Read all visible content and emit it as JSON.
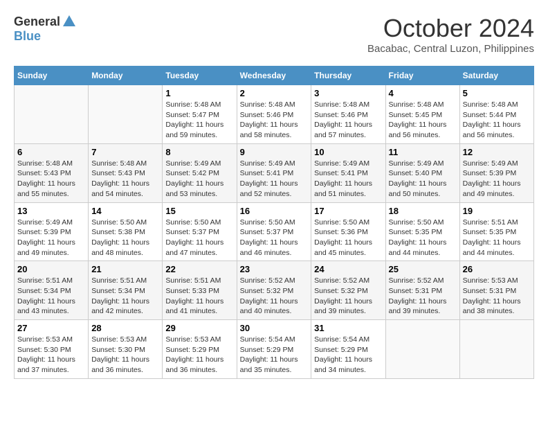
{
  "header": {
    "logo_general": "General",
    "logo_blue": "Blue",
    "month_title": "October 2024",
    "location": "Bacabac, Central Luzon, Philippines"
  },
  "weekdays": [
    "Sunday",
    "Monday",
    "Tuesday",
    "Wednesday",
    "Thursday",
    "Friday",
    "Saturday"
  ],
  "weeks": [
    [
      {
        "day": "",
        "sunrise": "",
        "sunset": "",
        "daylight": ""
      },
      {
        "day": "",
        "sunrise": "",
        "sunset": "",
        "daylight": ""
      },
      {
        "day": "1",
        "sunrise": "Sunrise: 5:48 AM",
        "sunset": "Sunset: 5:47 PM",
        "daylight": "Daylight: 11 hours and 59 minutes."
      },
      {
        "day": "2",
        "sunrise": "Sunrise: 5:48 AM",
        "sunset": "Sunset: 5:46 PM",
        "daylight": "Daylight: 11 hours and 58 minutes."
      },
      {
        "day": "3",
        "sunrise": "Sunrise: 5:48 AM",
        "sunset": "Sunset: 5:46 PM",
        "daylight": "Daylight: 11 hours and 57 minutes."
      },
      {
        "day": "4",
        "sunrise": "Sunrise: 5:48 AM",
        "sunset": "Sunset: 5:45 PM",
        "daylight": "Daylight: 11 hours and 56 minutes."
      },
      {
        "day": "5",
        "sunrise": "Sunrise: 5:48 AM",
        "sunset": "Sunset: 5:44 PM",
        "daylight": "Daylight: 11 hours and 56 minutes."
      }
    ],
    [
      {
        "day": "6",
        "sunrise": "Sunrise: 5:48 AM",
        "sunset": "Sunset: 5:43 PM",
        "daylight": "Daylight: 11 hours and 55 minutes."
      },
      {
        "day": "7",
        "sunrise": "Sunrise: 5:48 AM",
        "sunset": "Sunset: 5:43 PM",
        "daylight": "Daylight: 11 hours and 54 minutes."
      },
      {
        "day": "8",
        "sunrise": "Sunrise: 5:49 AM",
        "sunset": "Sunset: 5:42 PM",
        "daylight": "Daylight: 11 hours and 53 minutes."
      },
      {
        "day": "9",
        "sunrise": "Sunrise: 5:49 AM",
        "sunset": "Sunset: 5:41 PM",
        "daylight": "Daylight: 11 hours and 52 minutes."
      },
      {
        "day": "10",
        "sunrise": "Sunrise: 5:49 AM",
        "sunset": "Sunset: 5:41 PM",
        "daylight": "Daylight: 11 hours and 51 minutes."
      },
      {
        "day": "11",
        "sunrise": "Sunrise: 5:49 AM",
        "sunset": "Sunset: 5:40 PM",
        "daylight": "Daylight: 11 hours and 50 minutes."
      },
      {
        "day": "12",
        "sunrise": "Sunrise: 5:49 AM",
        "sunset": "Sunset: 5:39 PM",
        "daylight": "Daylight: 11 hours and 49 minutes."
      }
    ],
    [
      {
        "day": "13",
        "sunrise": "Sunrise: 5:49 AM",
        "sunset": "Sunset: 5:39 PM",
        "daylight": "Daylight: 11 hours and 49 minutes."
      },
      {
        "day": "14",
        "sunrise": "Sunrise: 5:50 AM",
        "sunset": "Sunset: 5:38 PM",
        "daylight": "Daylight: 11 hours and 48 minutes."
      },
      {
        "day": "15",
        "sunrise": "Sunrise: 5:50 AM",
        "sunset": "Sunset: 5:37 PM",
        "daylight": "Daylight: 11 hours and 47 minutes."
      },
      {
        "day": "16",
        "sunrise": "Sunrise: 5:50 AM",
        "sunset": "Sunset: 5:37 PM",
        "daylight": "Daylight: 11 hours and 46 minutes."
      },
      {
        "day": "17",
        "sunrise": "Sunrise: 5:50 AM",
        "sunset": "Sunset: 5:36 PM",
        "daylight": "Daylight: 11 hours and 45 minutes."
      },
      {
        "day": "18",
        "sunrise": "Sunrise: 5:50 AM",
        "sunset": "Sunset: 5:35 PM",
        "daylight": "Daylight: 11 hours and 44 minutes."
      },
      {
        "day": "19",
        "sunrise": "Sunrise: 5:51 AM",
        "sunset": "Sunset: 5:35 PM",
        "daylight": "Daylight: 11 hours and 44 minutes."
      }
    ],
    [
      {
        "day": "20",
        "sunrise": "Sunrise: 5:51 AM",
        "sunset": "Sunset: 5:34 PM",
        "daylight": "Daylight: 11 hours and 43 minutes."
      },
      {
        "day": "21",
        "sunrise": "Sunrise: 5:51 AM",
        "sunset": "Sunset: 5:34 PM",
        "daylight": "Daylight: 11 hours and 42 minutes."
      },
      {
        "day": "22",
        "sunrise": "Sunrise: 5:51 AM",
        "sunset": "Sunset: 5:33 PM",
        "daylight": "Daylight: 11 hours and 41 minutes."
      },
      {
        "day": "23",
        "sunrise": "Sunrise: 5:52 AM",
        "sunset": "Sunset: 5:32 PM",
        "daylight": "Daylight: 11 hours and 40 minutes."
      },
      {
        "day": "24",
        "sunrise": "Sunrise: 5:52 AM",
        "sunset": "Sunset: 5:32 PM",
        "daylight": "Daylight: 11 hours and 39 minutes."
      },
      {
        "day": "25",
        "sunrise": "Sunrise: 5:52 AM",
        "sunset": "Sunset: 5:31 PM",
        "daylight": "Daylight: 11 hours and 39 minutes."
      },
      {
        "day": "26",
        "sunrise": "Sunrise: 5:53 AM",
        "sunset": "Sunset: 5:31 PM",
        "daylight": "Daylight: 11 hours and 38 minutes."
      }
    ],
    [
      {
        "day": "27",
        "sunrise": "Sunrise: 5:53 AM",
        "sunset": "Sunset: 5:30 PM",
        "daylight": "Daylight: 11 hours and 37 minutes."
      },
      {
        "day": "28",
        "sunrise": "Sunrise: 5:53 AM",
        "sunset": "Sunset: 5:30 PM",
        "daylight": "Daylight: 11 hours and 36 minutes."
      },
      {
        "day": "29",
        "sunrise": "Sunrise: 5:53 AM",
        "sunset": "Sunset: 5:29 PM",
        "daylight": "Daylight: 11 hours and 36 minutes."
      },
      {
        "day": "30",
        "sunrise": "Sunrise: 5:54 AM",
        "sunset": "Sunset: 5:29 PM",
        "daylight": "Daylight: 11 hours and 35 minutes."
      },
      {
        "day": "31",
        "sunrise": "Sunrise: 5:54 AM",
        "sunset": "Sunset: 5:29 PM",
        "daylight": "Daylight: 11 hours and 34 minutes."
      },
      {
        "day": "",
        "sunrise": "",
        "sunset": "",
        "daylight": ""
      },
      {
        "day": "",
        "sunrise": "",
        "sunset": "",
        "daylight": ""
      }
    ]
  ]
}
